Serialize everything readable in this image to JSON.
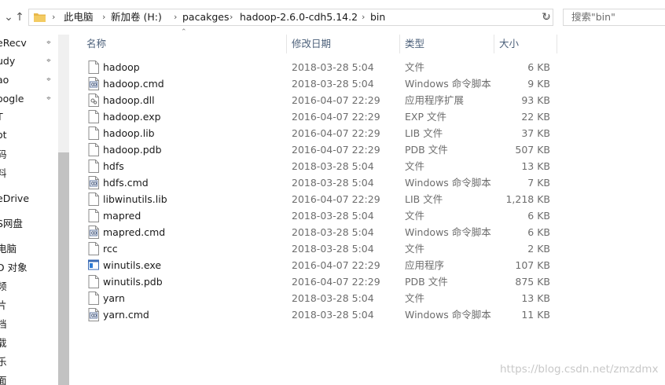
{
  "address_bar": {
    "path": [
      "此电脑",
      "新加卷 (H:)",
      "pacakges",
      "hadoop-2.6.0-cdh5.14.2",
      "bin"
    ]
  },
  "search": {
    "placeholder": "搜索\"bin\""
  },
  "nav_pane": {
    "items": [
      {
        "label": "eRecv",
        "pinned": true
      },
      {
        "label": "udy",
        "pinned": true
      },
      {
        "label": "ao",
        "pinned": true
      },
      {
        "label": "oogle",
        "pinned": true
      },
      {
        "label": "T",
        "pinned": false
      },
      {
        "label": "ot",
        "pinned": false
      },
      {
        "label": "码",
        "pinned": false
      },
      {
        "label": "料",
        "pinned": false
      },
      {
        "label": "eDrive",
        "pinned": false
      },
      {
        "label": "S网盘",
        "pinned": false
      },
      {
        "label": "电脑",
        "pinned": false
      },
      {
        "label": "D 对象",
        "pinned": false
      },
      {
        "label": "频",
        "pinned": false
      },
      {
        "label": "片",
        "pinned": false
      },
      {
        "label": "档",
        "pinned": false
      },
      {
        "label": "载",
        "pinned": false
      },
      {
        "label": "乐",
        "pinned": false
      },
      {
        "label": "面",
        "pinned": false
      }
    ]
  },
  "columns": {
    "name": "名称",
    "date": "修改日期",
    "type": "类型",
    "size": "大小"
  },
  "files": [
    {
      "name": "hadoop",
      "date": "2018-03-28 5:04",
      "type": "文件",
      "size": "6 KB",
      "icon": "blank-file-icon"
    },
    {
      "name": "hadoop.cmd",
      "date": "2018-03-28 5:04",
      "type": "Windows 命令脚本",
      "size": "9 KB",
      "icon": "cmd-script-icon"
    },
    {
      "name": "hadoop.dll",
      "date": "2016-04-07 22:29",
      "type": "应用程序扩展",
      "size": "93 KB",
      "icon": "dll-icon"
    },
    {
      "name": "hadoop.exp",
      "date": "2016-04-07 22:29",
      "type": "EXP 文件",
      "size": "22 KB",
      "icon": "blank-file-icon"
    },
    {
      "name": "hadoop.lib",
      "date": "2016-04-07 22:29",
      "type": "LIB 文件",
      "size": "37 KB",
      "icon": "blank-file-icon"
    },
    {
      "name": "hadoop.pdb",
      "date": "2016-04-07 22:29",
      "type": "PDB 文件",
      "size": "507 KB",
      "icon": "blank-file-icon"
    },
    {
      "name": "hdfs",
      "date": "2018-03-28 5:04",
      "type": "文件",
      "size": "13 KB",
      "icon": "blank-file-icon"
    },
    {
      "name": "hdfs.cmd",
      "date": "2018-03-28 5:04",
      "type": "Windows 命令脚本",
      "size": "7 KB",
      "icon": "cmd-script-icon"
    },
    {
      "name": "libwinutils.lib",
      "date": "2016-04-07 22:29",
      "type": "LIB 文件",
      "size": "1,218 KB",
      "icon": "blank-file-icon"
    },
    {
      "name": "mapred",
      "date": "2018-03-28 5:04",
      "type": "文件",
      "size": "6 KB",
      "icon": "blank-file-icon"
    },
    {
      "name": "mapred.cmd",
      "date": "2018-03-28 5:04",
      "type": "Windows 命令脚本",
      "size": "6 KB",
      "icon": "cmd-script-icon"
    },
    {
      "name": "rcc",
      "date": "2018-03-28 5:04",
      "type": "文件",
      "size": "2 KB",
      "icon": "blank-file-icon"
    },
    {
      "name": "winutils.exe",
      "date": "2016-04-07 22:29",
      "type": "应用程序",
      "size": "107 KB",
      "icon": "exe-icon"
    },
    {
      "name": "winutils.pdb",
      "date": "2016-04-07 22:29",
      "type": "PDB 文件",
      "size": "875 KB",
      "icon": "blank-file-icon"
    },
    {
      "name": "yarn",
      "date": "2018-03-28 5:04",
      "type": "文件",
      "size": "13 KB",
      "icon": "blank-file-icon"
    },
    {
      "name": "yarn.cmd",
      "date": "2018-03-28 5:04",
      "type": "Windows 命令脚本",
      "size": "11 KB",
      "icon": "cmd-script-icon"
    }
  ],
  "watermark": "https://blog.csdn.net/zmzdmx",
  "colors": {
    "header_text": "#4c607a",
    "secondary_text": "#6d6d6d",
    "folder": "#e8b84a"
  }
}
